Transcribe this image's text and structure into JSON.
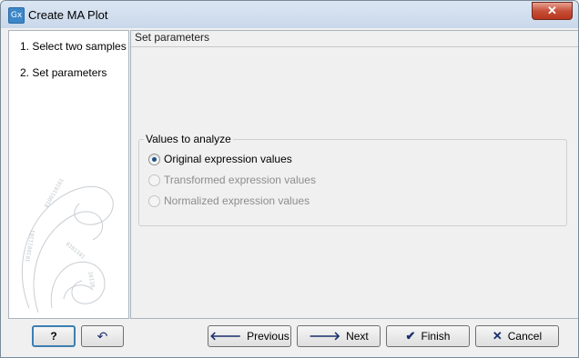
{
  "window": {
    "title": "Create MA Plot",
    "icon": "Gx",
    "close": "✕"
  },
  "sidebar": {
    "steps": [
      {
        "label": "1.   Select two samples"
      },
      {
        "label": "2.   Set parameters"
      }
    ]
  },
  "content": {
    "header": "Set parameters",
    "group": {
      "label": "Values to analyze",
      "options": [
        {
          "label": "Original expression values",
          "checked": true,
          "enabled": true
        },
        {
          "label": "Transformed expression values",
          "checked": false,
          "enabled": false
        },
        {
          "label": "Normalized expression values",
          "checked": false,
          "enabled": false
        }
      ]
    }
  },
  "buttons": {
    "help": "?",
    "undo": "↶",
    "previous": "Previous",
    "next": "Next",
    "finish": "Finish",
    "cancel": "Cancel"
  },
  "colors": {
    "accent": "#3c7fb1",
    "close": "#c7503a"
  }
}
